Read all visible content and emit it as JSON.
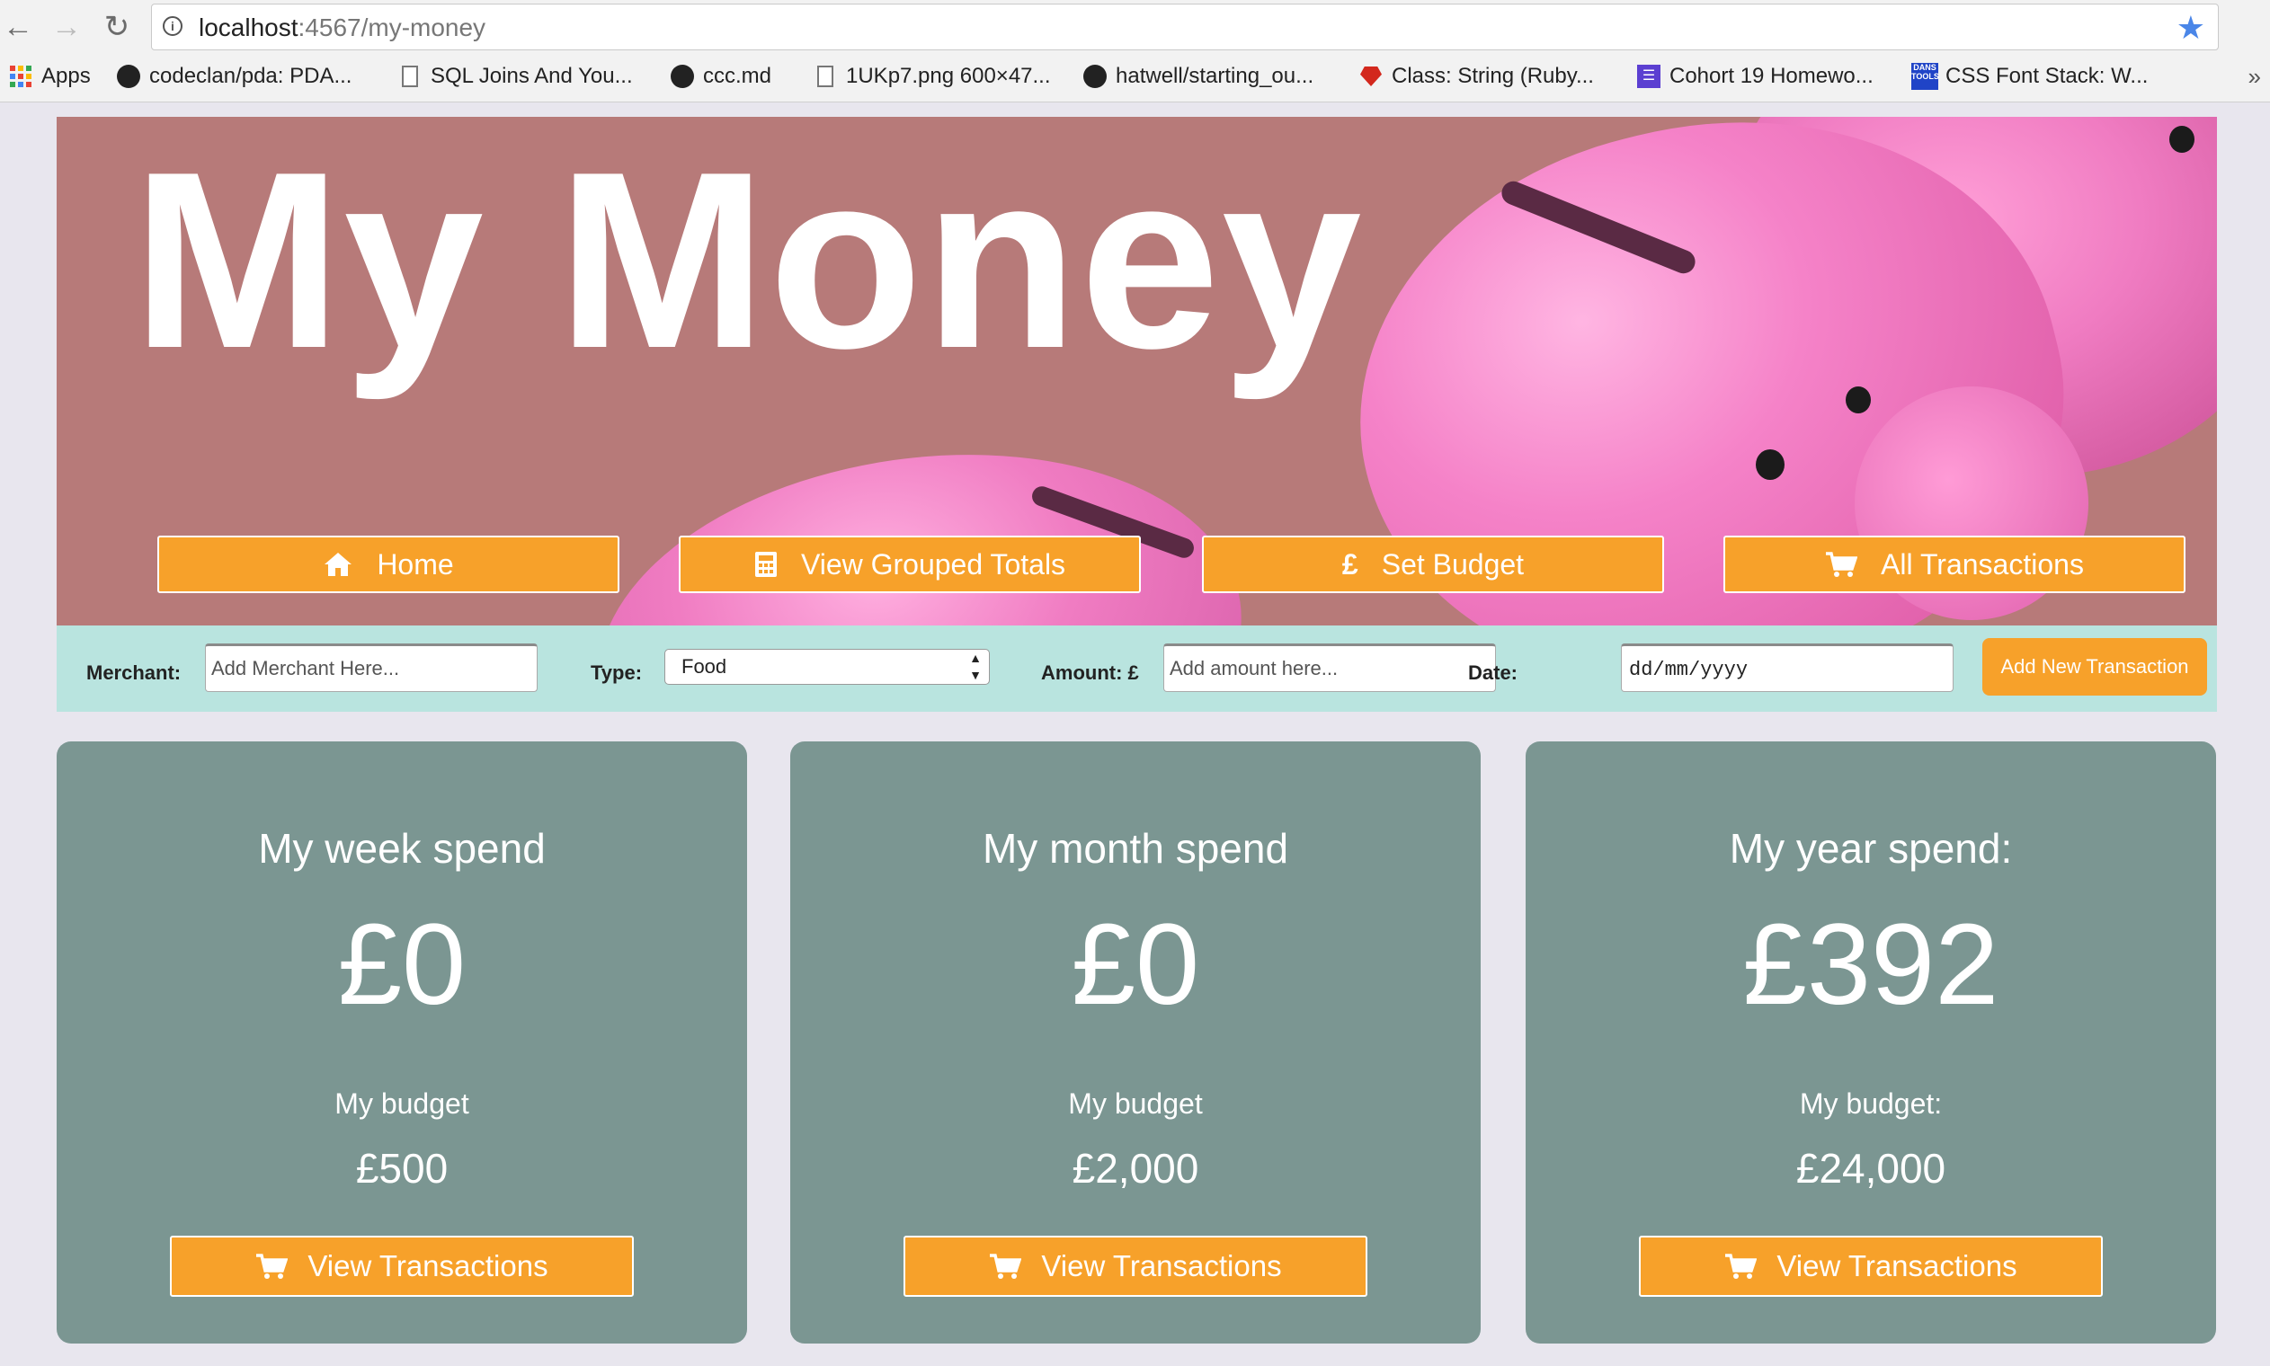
{
  "browser": {
    "url_host": "localhost",
    "url_path": ":4567/my-money",
    "bookmarks": [
      {
        "label": "Apps",
        "icon": "apps-icon"
      },
      {
        "label": "codeclan/pda: PDA...",
        "icon": "github-icon"
      },
      {
        "label": "SQL Joins And You...",
        "icon": "file-icon"
      },
      {
        "label": "ccc.md",
        "icon": "github-icon"
      },
      {
        "label": "1UKp7.png 600×47...",
        "icon": "file-icon"
      },
      {
        "label": "hatwell/starting_ou...",
        "icon": "github-icon"
      },
      {
        "label": "Class: String (Ruby...",
        "icon": "ruby-icon"
      },
      {
        "label": "Cohort 19 Homewo...",
        "icon": "cohort-icon"
      },
      {
        "label": "CSS Font Stack: W...",
        "icon": "dans-tools-icon"
      }
    ],
    "more": "»"
  },
  "hero": {
    "title": "My Money",
    "nav": [
      {
        "label": "Home",
        "icon": "home-icon"
      },
      {
        "label": "View Grouped Totals",
        "icon": "calculator-icon"
      },
      {
        "label": "Set Budget",
        "icon": "pound-icon"
      },
      {
        "label": "All Transactions",
        "icon": "cart-icon"
      }
    ]
  },
  "form": {
    "merchant_label": "Merchant:",
    "merchant_placeholder": "Add Merchant Here...",
    "type_label": "Type:",
    "type_value": "Food",
    "amount_label": "Amount: £",
    "amount_placeholder": "Add amount here...",
    "date_label": "Date:",
    "date_placeholder": "dd/mm/yyyy",
    "submit_label": "Add New Transaction"
  },
  "cards": [
    {
      "title": "My week spend",
      "amount": "£0",
      "budget_label": "My budget",
      "budget": "£500",
      "button": "View Transactions"
    },
    {
      "title": "My month spend",
      "amount": "£0",
      "budget_label": "My budget",
      "budget": "£2,000",
      "button": "View Transactions"
    },
    {
      "title": "My year spend:",
      "amount": "£392",
      "budget_label": "My budget:",
      "budget": "£24,000",
      "button": "View Transactions"
    }
  ],
  "colors": {
    "accent": "#f7a12a",
    "hero_bg": "#b77a79",
    "form_bg": "#b9e4df",
    "card_bg": "#7b9692",
    "page_bg": "#e8e6ee"
  }
}
